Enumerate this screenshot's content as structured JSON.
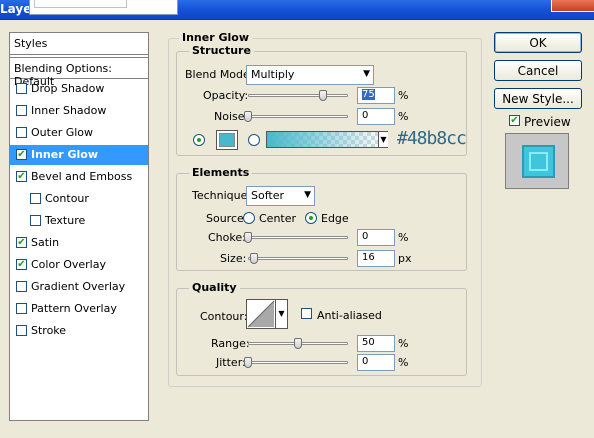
{
  "window": {
    "title_fragment": "Layer"
  },
  "styles_panel": {
    "header": "Styles",
    "blending_options": "Blending Options: Default",
    "items": [
      {
        "label": "Drop Shadow",
        "checked": false,
        "selected": false,
        "indent": false
      },
      {
        "label": "Inner Shadow",
        "checked": false,
        "selected": false,
        "indent": false
      },
      {
        "label": "Outer Glow",
        "checked": false,
        "selected": false,
        "indent": false
      },
      {
        "label": "Inner Glow",
        "checked": true,
        "selected": true,
        "indent": false
      },
      {
        "label": "Bevel and Emboss",
        "checked": true,
        "selected": false,
        "indent": false
      },
      {
        "label": "Contour",
        "checked": false,
        "selected": false,
        "indent": true
      },
      {
        "label": "Texture",
        "checked": false,
        "selected": false,
        "indent": true
      },
      {
        "label": "Satin",
        "checked": true,
        "selected": false,
        "indent": false
      },
      {
        "label": "Color Overlay",
        "checked": true,
        "selected": false,
        "indent": false
      },
      {
        "label": "Gradient Overlay",
        "checked": false,
        "selected": false,
        "indent": false
      },
      {
        "label": "Pattern Overlay",
        "checked": false,
        "selected": false,
        "indent": false
      },
      {
        "label": "Stroke",
        "checked": false,
        "selected": false,
        "indent": false
      }
    ]
  },
  "inner_glow": {
    "title": "Inner Glow",
    "structure": {
      "legend": "Structure",
      "blend_mode_label": "Blend Mode:",
      "blend_mode_value": "Multiply",
      "opacity_label": "Opacity:",
      "opacity_value": "75",
      "opacity_unit": "%",
      "opacity_level": 0.75,
      "noise_label": "Noise:",
      "noise_value": "0",
      "noise_unit": "%",
      "noise_level": 0,
      "glow_color": "#48b8cc",
      "color_annotation": "#48b8cc"
    },
    "elements": {
      "legend": "Elements",
      "technique_label": "Technique:",
      "technique_value": "Softer",
      "source_label": "Source:",
      "source_center": "Center",
      "source_edge": "Edge",
      "source_selected": "Edge",
      "choke_label": "Choke:",
      "choke_value": "0",
      "choke_unit": "%",
      "choke_level": 0,
      "size_label": "Size:",
      "size_value": "16",
      "size_unit": "px",
      "size_level": 0.06
    },
    "quality": {
      "legend": "Quality",
      "contour_label": "Contour:",
      "anti_aliased_label": "Anti-aliased",
      "anti_aliased_checked": false,
      "range_label": "Range:",
      "range_value": "50",
      "range_unit": "%",
      "range_level": 0.5,
      "jitter_label": "Jitter:",
      "jitter_value": "0",
      "jitter_unit": "%",
      "jitter_level": 0
    }
  },
  "buttons": {
    "ok": "OK",
    "cancel": "Cancel",
    "new_style": "New Style...",
    "preview_label": "Preview",
    "preview_checked": true
  },
  "colors": {
    "accent_selection": "#3399ff",
    "glow": "#48b8cc",
    "preview_swatch": "#3fc5dc"
  }
}
